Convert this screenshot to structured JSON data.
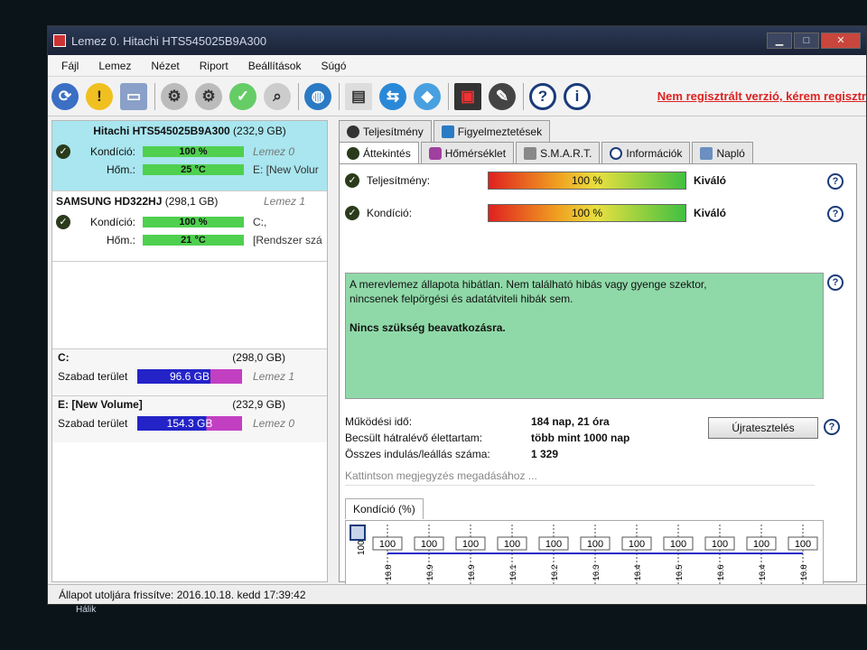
{
  "window": {
    "title": "Lemez 0. Hitachi HTS545025B9A300",
    "minimize": "▁",
    "maximize": "□",
    "close": "✕"
  },
  "menu": [
    "Fájl",
    "Lemez",
    "Nézet",
    "Riport",
    "Beállítások",
    "Súgó"
  ],
  "toolbar": {
    "register_link": "Nem regisztrált verzió, kérem regisztr"
  },
  "disks": [
    {
      "name": "Hitachi HTS545025B9A300",
      "size": "(232,9 GB)",
      "condition_label": "Kondíció:",
      "condition_value": "100 %",
      "condition_side": "Lemez 0",
      "temp_label": "Hőm.:",
      "temp_value": "25 °C",
      "temp_side": "E: [New Volur"
    },
    {
      "name": "SAMSUNG HD322HJ",
      "size": "(298,1 GB)",
      "size_side": "Lemez 1",
      "condition_label": "Kondíció:",
      "condition_value": "100 %",
      "condition_side": "C:,",
      "temp_label": "Hőm.:",
      "temp_value": "21 °C",
      "temp_side": "[Rendszer szá"
    }
  ],
  "volumes": [
    {
      "name": "C:",
      "size": "(298,0 GB)",
      "free_label": "Szabad terület",
      "free_value": "96.6 GB",
      "disk": "Lemez 1"
    },
    {
      "name": "E: [New Volume]",
      "size": "(232,9 GB)",
      "free_label": "Szabad terület",
      "free_value": "154.3 GB",
      "disk": "Lemez 0"
    }
  ],
  "tabs_top": [
    "Teljesítmény",
    "Figyelmeztetések"
  ],
  "tabs_bottom": [
    "Áttekintés",
    "Hőmérséklet",
    "S.M.A.R.T.",
    "Információk",
    "Napló"
  ],
  "overview": {
    "performance_label": "Teljesítmény:",
    "performance_value": "100 %",
    "performance_rating": "Kiváló",
    "condition_label": "Kondíció:",
    "condition_value": "100 %",
    "condition_rating": "Kiváló",
    "summary_line1": "A merevlemez állapota hibátlan. Nem található hibás vagy gyenge szektor,",
    "summary_line2": "nincsenek felpörgési és adatátviteli hibák sem.",
    "advice": "Nincs szükség beavatkozásra.",
    "uptime_label": "Működési idő:",
    "uptime_value": "184 nap, 21 óra",
    "lifetime_label": "Becsült hátralévő élettartam:",
    "lifetime_value": "több mint 1000 nap",
    "startstop_label": "Összes indulás/leállás száma:",
    "startstop_value": "1 329",
    "retest_button": "Újratesztelés",
    "note_placeholder": "Kattintson megjegyzés megadásához ...",
    "chart_tab": "Kondíció (%)",
    "help": "?"
  },
  "chart_data": {
    "type": "line",
    "values": [
      100,
      100,
      100,
      100,
      100,
      100,
      100,
      100,
      100,
      100,
      100
    ],
    "y_tick": "100",
    "x_labels": [
      "16.8",
      "16.9",
      "16.9",
      "16.1",
      "16.2",
      "16.3",
      "16.4",
      "16.5",
      "16.6",
      "16.4",
      "16.8"
    ],
    "series_color": "#2323c8"
  },
  "status": {
    "text": "Állapot utoljára frissítve: 2016.10.18. kedd 17:39:42"
  },
  "taskbar": {
    "text": "Hálik"
  }
}
